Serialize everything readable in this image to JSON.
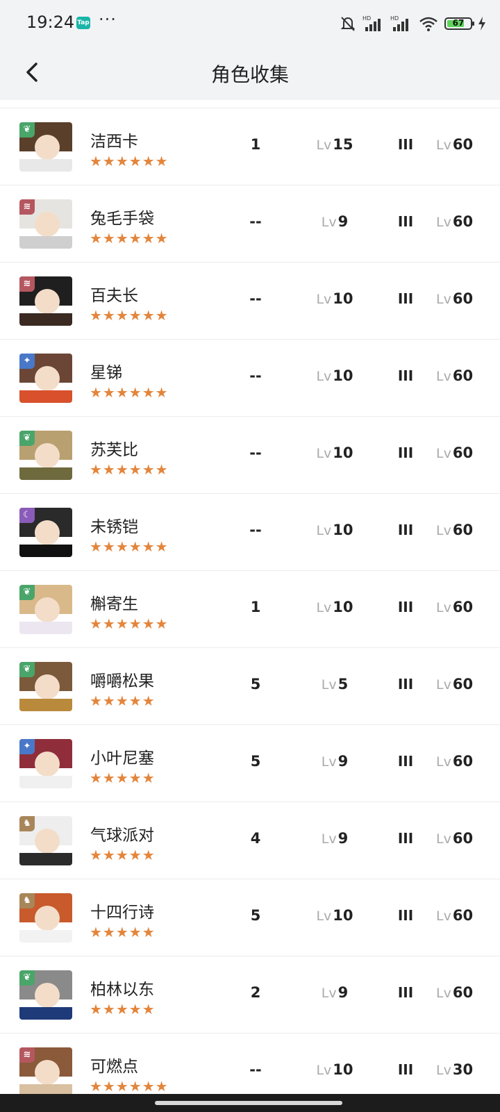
{
  "status_bar": {
    "time": "19:24",
    "tap_badge": "Tap",
    "more": "···",
    "battery": "67"
  },
  "header": {
    "title": "角色收集"
  },
  "rows": [
    {
      "name": "洁西卡",
      "stars": "★★★★★★",
      "a": "1",
      "b_prefix": "Lv",
      "b": "15",
      "c": "III",
      "d_prefix": "Lv",
      "d": "60",
      "element": "leaf",
      "elem_color": "#4aa56a",
      "hair": "#5a3f2a",
      "cloth": "#e8e8e8"
    },
    {
      "name": "兔毛手袋",
      "stars": "★★★★★★",
      "a": "--",
      "b_prefix": "Lv",
      "b": "9",
      "c": "III",
      "d_prefix": "Lv",
      "d": "60",
      "element": "wind",
      "elem_color": "#b5575f",
      "hair": "#e6e4e0",
      "cloth": "#cfcfcf"
    },
    {
      "name": "百夫长",
      "stars": "★★★★★★",
      "a": "--",
      "b_prefix": "Lv",
      "b": "10",
      "c": "III",
      "d_prefix": "Lv",
      "d": "60",
      "element": "wind",
      "elem_color": "#b5575f",
      "hair": "#1f1f1f",
      "cloth": "#3a2a22"
    },
    {
      "name": "星锑",
      "stars": "★★★★★★",
      "a": "--",
      "b_prefix": "Lv",
      "b": "10",
      "c": "III",
      "d_prefix": "Lv",
      "d": "60",
      "element": "star",
      "elem_color": "#4a78c8",
      "hair": "#6b4636",
      "cloth": "#d8512c"
    },
    {
      "name": "苏芙比",
      "stars": "★★★★★★",
      "a": "--",
      "b_prefix": "Lv",
      "b": "10",
      "c": "III",
      "d_prefix": "Lv",
      "d": "60",
      "element": "leaf",
      "elem_color": "#4aa56a",
      "hair": "#b9a070",
      "cloth": "#6f6a3e"
    },
    {
      "name": "未锈铠",
      "stars": "★★★★★★",
      "a": "--",
      "b_prefix": "Lv",
      "b": "10",
      "c": "III",
      "d_prefix": "Lv",
      "d": "60",
      "element": "moon",
      "elem_color": "#8a5bb8",
      "hair": "#2a2a2a",
      "cloth": "#111111"
    },
    {
      "name": "槲寄生",
      "stars": "★★★★★★",
      "a": "1",
      "b_prefix": "Lv",
      "b": "10",
      "c": "III",
      "d_prefix": "Lv",
      "d": "60",
      "element": "leaf",
      "elem_color": "#4aa56a",
      "hair": "#d9b98a",
      "cloth": "#ece6f0"
    },
    {
      "name": "嚼嚼松果",
      "stars": "★★★★★",
      "a": "5",
      "b_prefix": "Lv",
      "b": "5",
      "c": "III",
      "d_prefix": "Lv",
      "d": "60",
      "element": "leaf",
      "elem_color": "#4aa56a",
      "hair": "#7a5a3a",
      "cloth": "#b98a3c"
    },
    {
      "name": "小叶尼塞",
      "stars": "★★★★★",
      "a": "5",
      "b_prefix": "Lv",
      "b": "9",
      "c": "III",
      "d_prefix": "Lv",
      "d": "60",
      "element": "star",
      "elem_color": "#4a78c8",
      "hair": "#8f2e3a",
      "cloth": "#f0f0f0"
    },
    {
      "name": "气球派对",
      "stars": "★★★★★",
      "a": "4",
      "b_prefix": "Lv",
      "b": "9",
      "c": "III",
      "d_prefix": "Lv",
      "d": "60",
      "element": "beast",
      "elem_color": "#a8865a",
      "hair": "#eeeeee",
      "cloth": "#2b2b2b"
    },
    {
      "name": "十四行诗",
      "stars": "★★★★★",
      "a": "5",
      "b_prefix": "Lv",
      "b": "10",
      "c": "III",
      "d_prefix": "Lv",
      "d": "60",
      "element": "beast",
      "elem_color": "#a8865a",
      "hair": "#c85a2c",
      "cloth": "#f2f2f2"
    },
    {
      "name": "柏林以东",
      "stars": "★★★★★",
      "a": "2",
      "b_prefix": "Lv",
      "b": "9",
      "c": "III",
      "d_prefix": "Lv",
      "d": "60",
      "element": "leaf",
      "elem_color": "#4aa56a",
      "hair": "#8a8a8a",
      "cloth": "#1e3a78"
    },
    {
      "name": "可燃点",
      "stars": "★★★★★★",
      "a": "--",
      "b_prefix": "Lv",
      "b": "10",
      "c": "III",
      "d_prefix": "Lv",
      "d": "30",
      "element": "wind",
      "elem_color": "#b5575f",
      "hair": "#8a5a3a",
      "cloth": "#d9c0a0"
    }
  ]
}
